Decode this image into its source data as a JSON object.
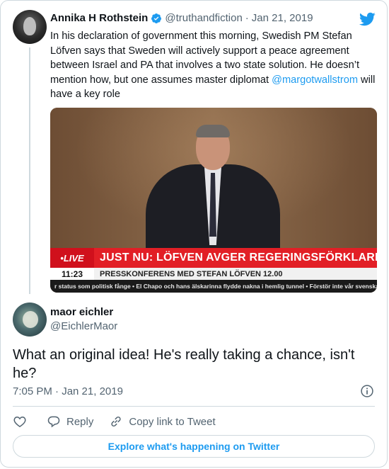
{
  "quoted_tweet": {
    "author_name": "Annika H Rothstein",
    "handle": "@truthandfiction",
    "separator": "·",
    "date": "Jan 21, 2019",
    "text_before_mention": "In his declaration of government this morning, Swedish PM Stefan Löfven says that Sweden will actively support a peace agreement between Israel and PA that involves a two state solution. He doesn’t mention how, but one assumes master diplomat ",
    "mention": "@margotwallstrom",
    "text_after_mention": " will have a key role",
    "media": {
      "live_label": "•LIVE",
      "headline": "JUST NU: LÖFVEN AVGER REGERINGSFÖRKLARINGEN",
      "time": "11:23",
      "subheadline": "PRESSKONFERENS MED STEFAN LÖFVEN 12.00",
      "ticker": "r status som politisk fånge • El Chapo och hans älskarinna flydde nakna i hemlig tunnel • Förstör inte vår svenska m"
    }
  },
  "main_tweet": {
    "author_name": "maor eichler",
    "handle": "@EichlerMaor",
    "text": "What an original idea! He's really taking a chance, isn't he?",
    "timestamp": "7:05 PM · Jan 21, 2019"
  },
  "actions": {
    "reply_label": "Reply",
    "copy_link_label": "Copy link to Tweet"
  },
  "footer": {
    "explore_label": "Explore what's happening on Twitter"
  },
  "colors": {
    "accent": "#1d9bf0",
    "text_primary": "#0f1419",
    "text_secondary": "#536471",
    "border": "#cfd9de",
    "news_red": "#e21f26"
  },
  "icons": {
    "verified": "verified-badge-icon",
    "brand": "twitter-bird-icon",
    "info": "info-icon",
    "like": "heart-icon",
    "reply": "reply-bubble-icon",
    "copy_link": "link-icon"
  }
}
